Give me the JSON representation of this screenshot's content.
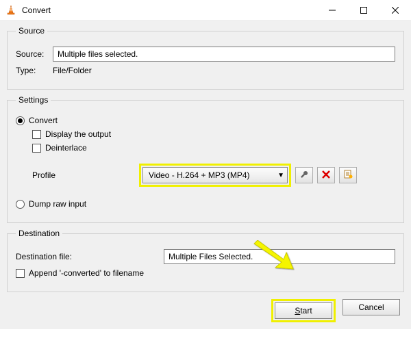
{
  "titlebar": {
    "title": "Convert"
  },
  "source": {
    "legend": "Source",
    "source_label": "Source:",
    "source_value": "Multiple files selected.",
    "type_label": "Type:",
    "type_value": "File/Folder"
  },
  "settings": {
    "legend": "Settings",
    "convert_label": "Convert",
    "display_output_label": "Display the output",
    "deinterlace_label": "Deinterlace",
    "profile_label": "Profile",
    "profile_value": "Video - H.264 + MP3 (MP4)",
    "dump_raw_label": "Dump raw input"
  },
  "destination": {
    "legend": "Destination",
    "dest_label": "Destination file:",
    "dest_value": "Multiple Files Selected.",
    "append_label": "Append '-converted' to filename"
  },
  "buttons": {
    "start_prefix": "S",
    "start_rest": "tart",
    "cancel": "Cancel"
  }
}
